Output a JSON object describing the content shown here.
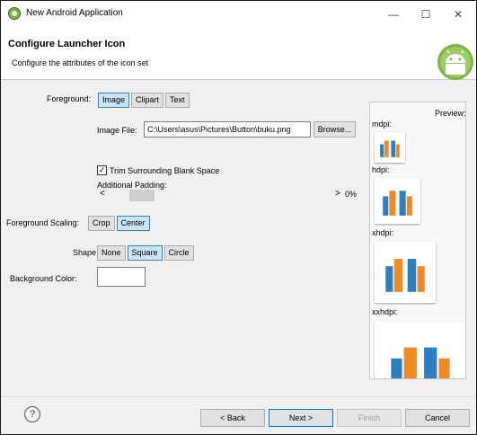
{
  "window": {
    "title": "New Android Application",
    "minimize_glyph": "—",
    "maximize_glyph": "☐",
    "close_glyph": "✕"
  },
  "banner": {
    "title": "Configure Launcher Icon",
    "description": "Configure the attributes of the icon set"
  },
  "foreground": {
    "label": "Foreground:",
    "options": [
      "Image",
      "Clipart",
      "Text"
    ],
    "selected": "Image"
  },
  "image_file": {
    "label": "Image File:",
    "value": "C:\\Users\\asus\\Pictures\\Button\\buku.png",
    "browse_label": "Browse..."
  },
  "trim": {
    "checkbox_glyph": "✓",
    "label": "Trim Surrounding Blank Space",
    "checked": true
  },
  "padding": {
    "label": "Additional Padding:",
    "left_arrow": "<",
    "right_arrow": ">",
    "value_text": "0%"
  },
  "scaling": {
    "label": "Foreground Scaling:",
    "options": [
      "Crop",
      "Center"
    ],
    "selected": "Center"
  },
  "shape": {
    "label": "Shape",
    "options": [
      "None",
      "Square",
      "Circle"
    ],
    "selected": "Square"
  },
  "background": {
    "label": "Background Color:",
    "color": "#ffffff"
  },
  "preview": {
    "title": "Preview:",
    "densities": [
      "mdpi:",
      "hdpi:",
      "xhdpi:",
      "xxhdpi:"
    ]
  },
  "footer": {
    "help_glyph": "?",
    "back_label": "< Back",
    "next_label": "Next >",
    "finish_label": "Finish",
    "cancel_label": "Cancel"
  },
  "colors": {
    "accent_blue": "#3c7fb1",
    "selected_fill": "#cce4f7",
    "book_blue": "#2e7fc1",
    "book_orange": "#f08a24"
  }
}
